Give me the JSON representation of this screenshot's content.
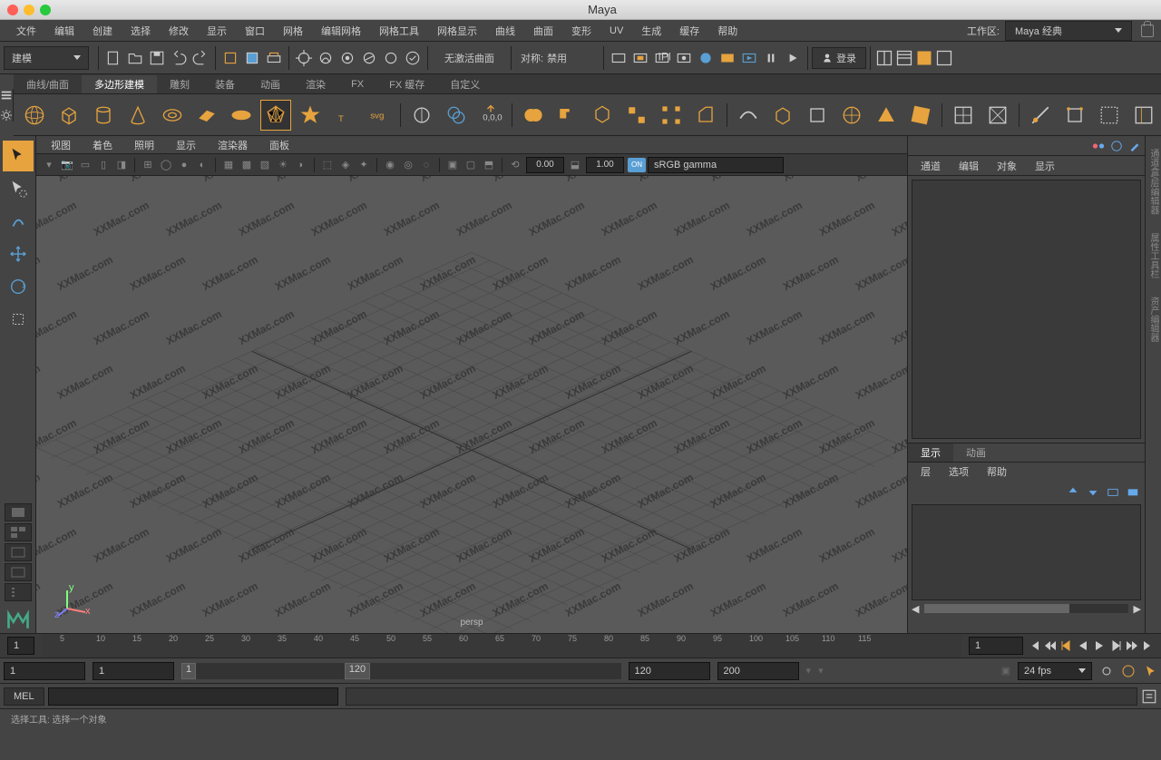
{
  "title": "Maya",
  "menus": [
    "文件",
    "编辑",
    "创建",
    "选择",
    "修改",
    "显示",
    "窗口",
    "网格",
    "编辑网格",
    "网格工具",
    "网格显示",
    "曲线",
    "曲面",
    "变形",
    "UV",
    "生成",
    "缓存",
    "帮助"
  ],
  "workspace": {
    "label": "工作区:",
    "selected": "Maya 经典"
  },
  "mode_dropdown": "建模",
  "status_center": "无激活曲面",
  "symmetry": {
    "label": "对称:",
    "value": "禁用"
  },
  "login": "登录",
  "shelf_tabs": [
    "曲线/曲面",
    "多边形建模",
    "雕刻",
    "装备",
    "动画",
    "渲染",
    "FX",
    "FX 缓存",
    "自定义"
  ],
  "shelf_active": 1,
  "panel_menus": [
    "视图",
    "着色",
    "照明",
    "显示",
    "渲染器",
    "面板"
  ],
  "viewport_toolbar": {
    "num1": "0.00",
    "num2": "1.00",
    "toggle": "ON",
    "gamma": "sRGB gamma"
  },
  "viewport_camera": "persp",
  "watermark_text": "XXMac.com",
  "channel_box": {
    "menus": [
      "通道",
      "编辑",
      "对象",
      "显示"
    ]
  },
  "layer_tabs": [
    "显示",
    "动画"
  ],
  "layer_active": 0,
  "layer_menus": [
    "层",
    "选项",
    "帮助"
  ],
  "right_vtabs": [
    "通道盒/层编辑器",
    "属性工具栏",
    "资产编辑器"
  ],
  "timeline": {
    "start": 1,
    "ticks": [
      5,
      10,
      15,
      20,
      25,
      30,
      35,
      40,
      45,
      50,
      55,
      60,
      65,
      70,
      75,
      80,
      85,
      90,
      95,
      100,
      105,
      110,
      115
    ],
    "cur_field": "1"
  },
  "range": {
    "start_outer": "1",
    "start_inner": "1",
    "end_inner": "120",
    "end_outer": "200",
    "rb1": "1",
    "rb2": "120",
    "fps": "24 fps"
  },
  "cmd_label": "MEL",
  "helpline": "选择工具: 选择一个对象"
}
